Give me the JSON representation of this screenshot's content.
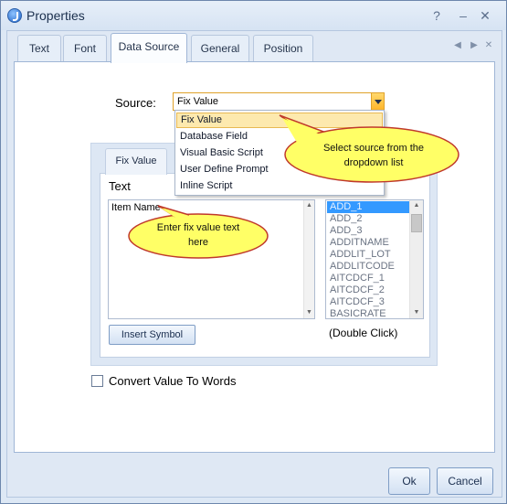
{
  "window": {
    "title": "Properties"
  },
  "tabs": [
    {
      "label": "Text"
    },
    {
      "label": "Font"
    },
    {
      "label": "Data Source"
    },
    {
      "label": "General"
    },
    {
      "label": "Position"
    }
  ],
  "active_tab": "Data Source",
  "source": {
    "label": "Source:",
    "value": "Fix Value",
    "options": [
      "Fix Value",
      "Database Field",
      "Visual Basic Script",
      "User Define Prompt",
      "Inline Script"
    ],
    "highlighted_option": "Fix Value"
  },
  "inner_tab": {
    "label": "Fix Value"
  },
  "text_section": {
    "label": "Text",
    "value": "Item Name",
    "insert_button": "Insert Symbol",
    "list_items": [
      "ADD_1",
      "ADD_2",
      "ADD_3",
      "ADDITNAME",
      "ADDLIT_LOT",
      "ADDLITCODE",
      "AITCDCF_1",
      "AITCDCF_2",
      "AITCDCF_3",
      "BASICRATE"
    ],
    "selected_item": "ADD_1",
    "list_hint": "(Double Click)"
  },
  "checkbox": {
    "label": "Convert Value To Words",
    "checked": false
  },
  "callouts": {
    "source_hint": "Select  source  from  the\ndropdown   list",
    "text_hint": "Enter  fix  value  text\nhere"
  },
  "buttons": {
    "ok": "Ok",
    "cancel": "Cancel"
  },
  "colors": {
    "accent": "#3399ff",
    "highlight": "#fde9ae",
    "callout_fill": "#ffff66"
  }
}
